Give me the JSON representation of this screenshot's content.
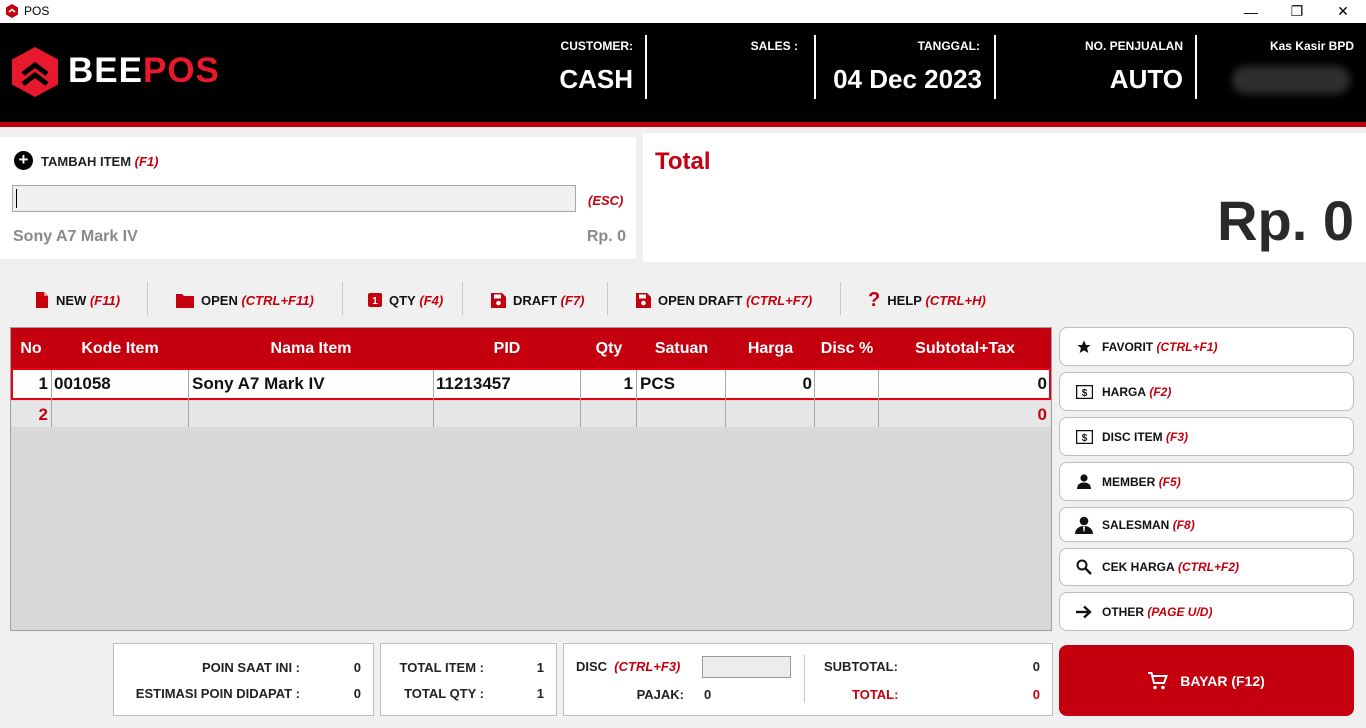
{
  "window": {
    "title": "POS",
    "minimize_glyph": "—",
    "maximize_glyph": "❐",
    "close_glyph": "✕"
  },
  "header": {
    "logo_part1": "BEE",
    "logo_part2": "POS",
    "customer_label": "CUSTOMER:",
    "customer_value": "CASH",
    "sales_label": "SALES :",
    "sales_value": "",
    "date_label": "TANGGAL:",
    "date_value": "04 Dec 2023",
    "sale_no_label": "NO. PENJUALAN",
    "sale_no_value": "AUTO",
    "cashier_label": "Kas Kasir BPD"
  },
  "add_item": {
    "label": "TAMBAH ITEM",
    "shortcut": "(F1)",
    "esc_shortcut": "(ESC)",
    "input_value": "",
    "last_item_name": "Sony A7 Mark IV",
    "last_item_price": "Rp. 0"
  },
  "total_panel": {
    "title": "Total",
    "amount": "Rp. 0"
  },
  "toolbar": [
    {
      "label": "NEW",
      "shortcut": "(F11)",
      "icon": "file-icon"
    },
    {
      "label": "OPEN",
      "shortcut": "(CTRL+F11)",
      "icon": "folder-icon"
    },
    {
      "label": "QTY",
      "shortcut": "(F4)",
      "icon": "qty-icon"
    },
    {
      "label": "DRAFT",
      "shortcut": "(F7)",
      "icon": "save-icon"
    },
    {
      "label": "OPEN DRAFT",
      "shortcut": "(CTRL+F7)",
      "icon": "save-icon"
    },
    {
      "label": "HELP",
      "shortcut": "(CTRL+H)",
      "icon": "question-icon"
    }
  ],
  "table": {
    "columns": [
      "No",
      "Kode Item",
      "Nama Item",
      "PID",
      "Qty",
      "Satuan",
      "Harga",
      "Disc %",
      "Subtotal+Tax"
    ],
    "rows": [
      {
        "no": "1",
        "kode": "001058",
        "nama": "Sony A7 Mark IV",
        "pid": "11213457",
        "qty": "1",
        "satuan": "PCS",
        "harga": "0",
        "disc": "",
        "subtotal": "0"
      },
      {
        "no": "2",
        "kode": "",
        "nama": "",
        "pid": "",
        "qty": "",
        "satuan": "",
        "harga": "",
        "disc": "",
        "subtotal": "0"
      }
    ]
  },
  "side_buttons": [
    {
      "label": "FAVORIT",
      "shortcut": "(CTRL+F1)",
      "icon": "star-icon"
    },
    {
      "label": "HARGA",
      "shortcut": "(F2)",
      "icon": "money-icon"
    },
    {
      "label": "DISC ITEM",
      "shortcut": "(F3)",
      "icon": "money-icon"
    },
    {
      "label": "MEMBER",
      "shortcut": "(F5)",
      "icon": "user-icon"
    },
    {
      "label": "SALESMAN",
      "shortcut": "(F8)",
      "icon": "salesman-icon"
    },
    {
      "label": "CEK HARGA",
      "shortcut": "(CTRL+F2)",
      "icon": "search-icon"
    },
    {
      "label": "OTHER",
      "shortcut": "(PAGE U/D)",
      "icon": "arrow-right-icon"
    }
  ],
  "summary": {
    "poin_label": "POIN SAAT INI :",
    "poin_value": "0",
    "estimasi_label": "ESTIMASI POIN DIDAPAT :",
    "estimasi_value": "0",
    "total_item_label": "TOTAL ITEM :",
    "total_item_value": "1",
    "total_qty_label": "TOTAL QTY :",
    "total_qty_value": "1",
    "disc_label": "DISC",
    "disc_shortcut": "(CTRL+F3)",
    "disc_value": "",
    "pajak_label": "PAJAK:",
    "pajak_value": "0",
    "subtotal_label": "SUBTOTAL:",
    "subtotal_value": "0",
    "total_label": "TOTAL:",
    "total_value": "0"
  },
  "pay_button": {
    "label": "BAYAR (F12)",
    "icon": "cart-icon"
  },
  "colors": {
    "brand_red": "#c4000f",
    "header_bg": "#000000"
  }
}
